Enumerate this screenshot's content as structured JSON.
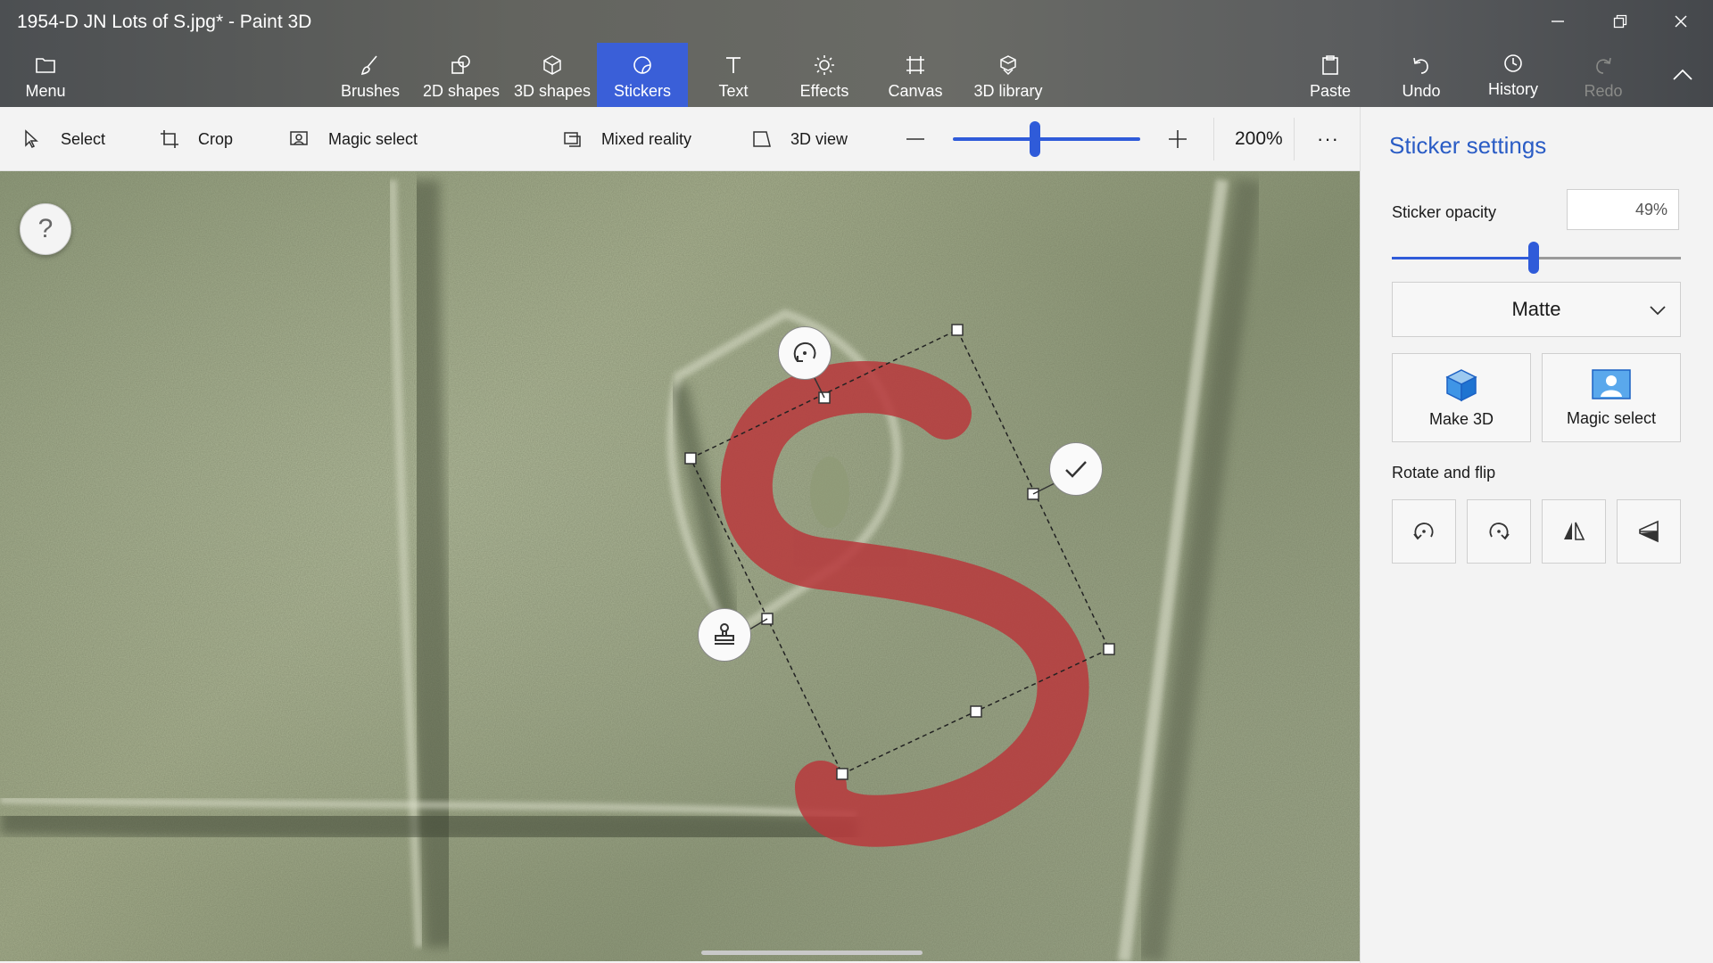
{
  "window": {
    "title": "1954-D JN Lots of S.jpg* - Paint 3D",
    "minimize_icon": "minimize-icon",
    "restore_icon": "restore-icon",
    "close_icon": "close-icon"
  },
  "ribbon": {
    "menu_label": "Menu",
    "tools": [
      {
        "label": "Brushes",
        "icon": "brush-icon"
      },
      {
        "label": "2D shapes",
        "icon": "2d-shapes-icon"
      },
      {
        "label": "3D shapes",
        "icon": "3d-shapes-icon"
      },
      {
        "label": "Stickers",
        "icon": "sticker-icon",
        "active": true
      },
      {
        "label": "Text",
        "icon": "text-icon"
      },
      {
        "label": "Effects",
        "icon": "effects-icon"
      },
      {
        "label": "Canvas",
        "icon": "canvas-icon"
      },
      {
        "label": "3D library",
        "icon": "3d-library-icon"
      }
    ],
    "paste_label": "Paste",
    "undo_label": "Undo",
    "history_label": "History",
    "redo_label": "Redo",
    "accent_color": "#3a5fd8"
  },
  "toolbar": {
    "select_label": "Select",
    "crop_label": "Crop",
    "magic_select_label": "Magic select",
    "mixed_reality_label": "Mixed reality",
    "view_3d_label": "3D view",
    "zoom_value": "200%",
    "zoom_level_fraction": 0.44,
    "more_label": "···"
  },
  "canvas": {
    "help_label": "?",
    "sticker": {
      "glyph": "S",
      "color": "#b8383c",
      "rotate_icon": "rotate-handle-icon",
      "confirm_icon": "checkmark-icon",
      "stamp_icon": "stamp-icon"
    }
  },
  "panel": {
    "title": "Sticker settings",
    "opacity_label": "Sticker opacity",
    "opacity_value": "49%",
    "opacity_fraction": 0.49,
    "finish_value": "Matte",
    "make3d_label": "Make 3D",
    "magic_select_label": "Magic select",
    "rotate_flip_label": "Rotate and flip",
    "rotate_buttons": [
      "rotate-left-icon",
      "rotate-right-icon",
      "flip-horizontal-icon",
      "flip-vertical-icon"
    ]
  }
}
